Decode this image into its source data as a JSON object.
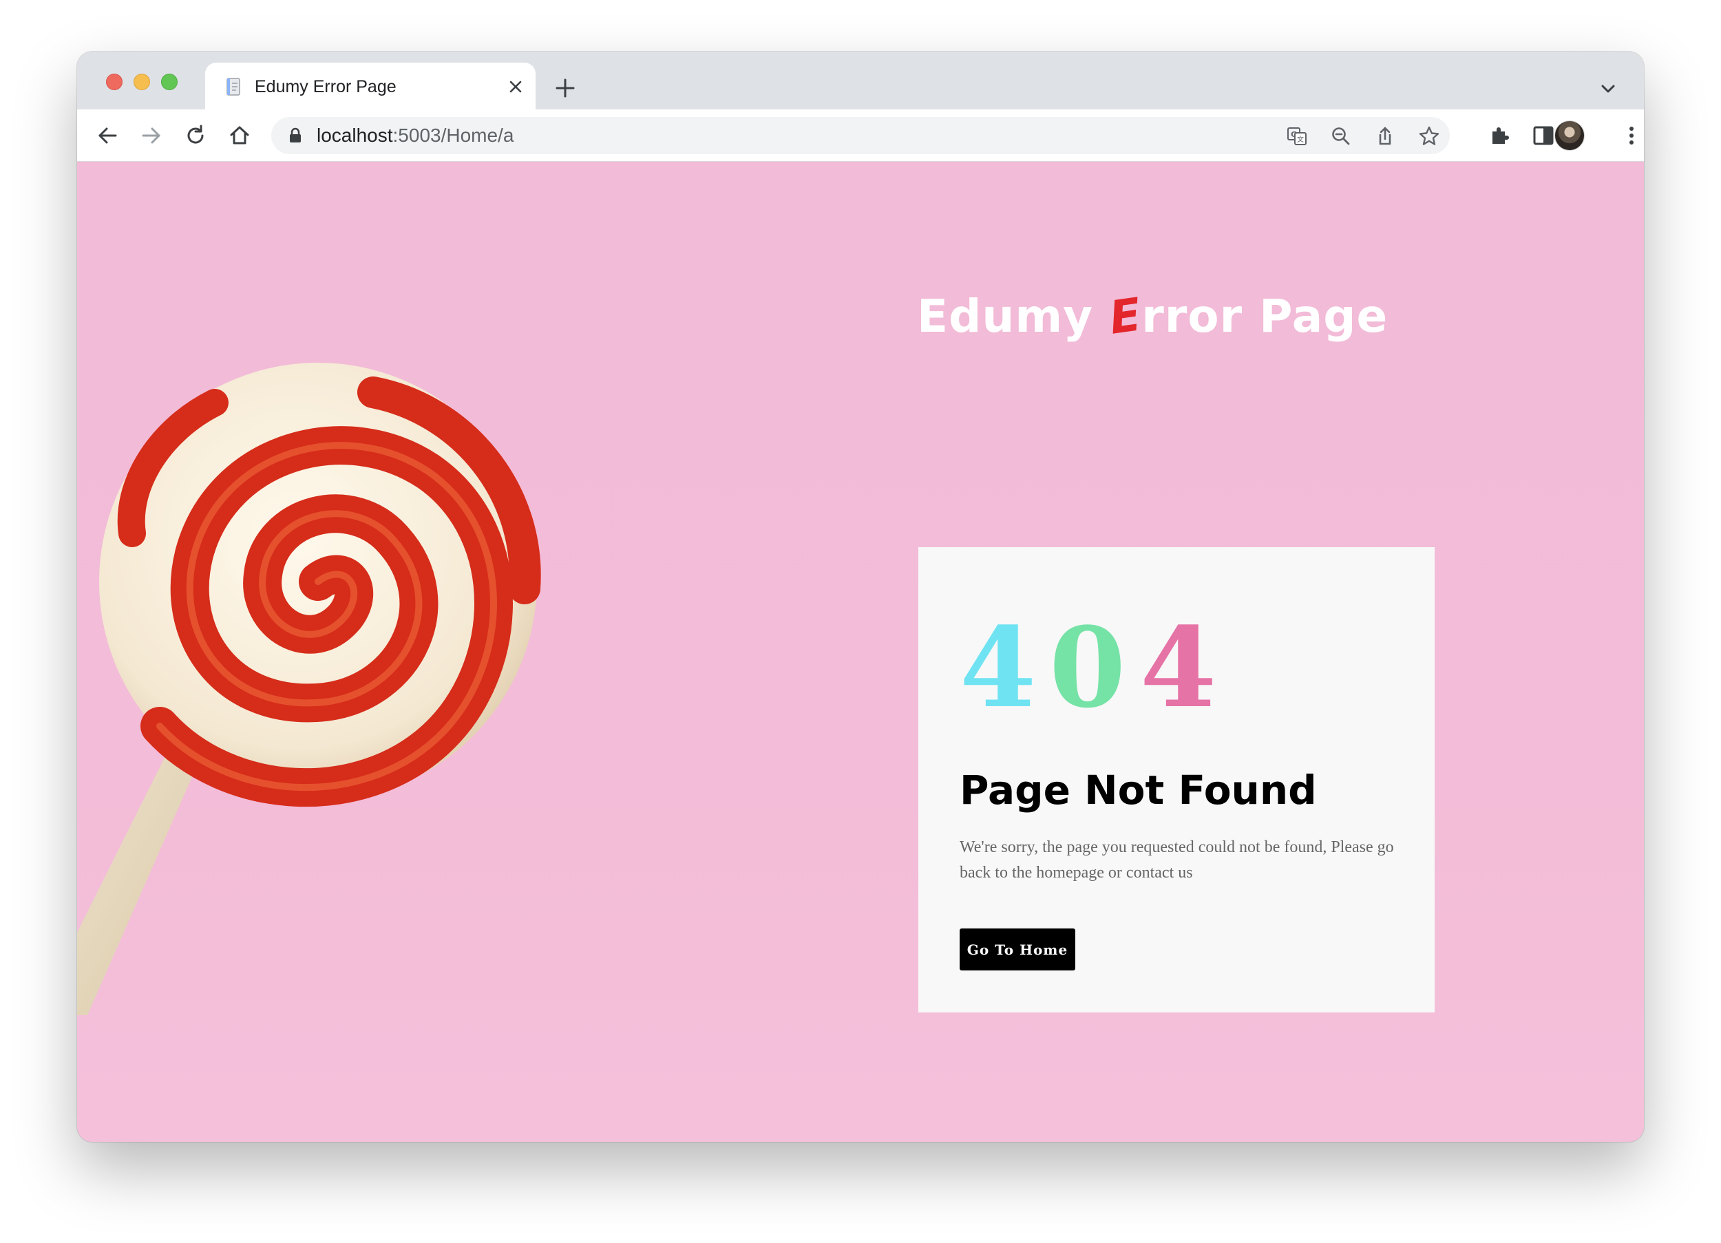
{
  "browser": {
    "tab": {
      "title": "Edumy Error Page",
      "favicon": "page-icon",
      "close": "close-icon"
    },
    "new_tab": "plus-icon",
    "tab_search": "chevron-down-icon",
    "nav": {
      "back": "arrow-left-icon",
      "forward": "arrow-right-icon",
      "reload": "reload-icon",
      "home": "home-icon"
    },
    "address": {
      "host": "localhost",
      "path": ":5003/Home/a",
      "lock": "lock-icon"
    },
    "omnibox_icons": [
      "translate-icon",
      "zoom-out-icon",
      "share-icon",
      "star-icon"
    ],
    "toolbar_icons": [
      "extensions-icon",
      "side-panel-icon",
      "avatar",
      "kebab-menu-icon"
    ]
  },
  "page": {
    "brand": {
      "before": "Edumy ",
      "e": "E",
      "after": "rror Page"
    },
    "card": {
      "digits": [
        "4",
        "0",
        "4"
      ],
      "title": "Page Not Found",
      "text": "We're sorry, the page you requested could not be found, Please go back to the homepage or contact us",
      "button": "Go To Home"
    },
    "colors": {
      "background": "#f3bdd6",
      "brand_e": "#e3262b",
      "digit1": "#6fe3f2",
      "digit2": "#75e2a6",
      "digit3": "#e673a6",
      "button_bg": "#000000"
    }
  }
}
